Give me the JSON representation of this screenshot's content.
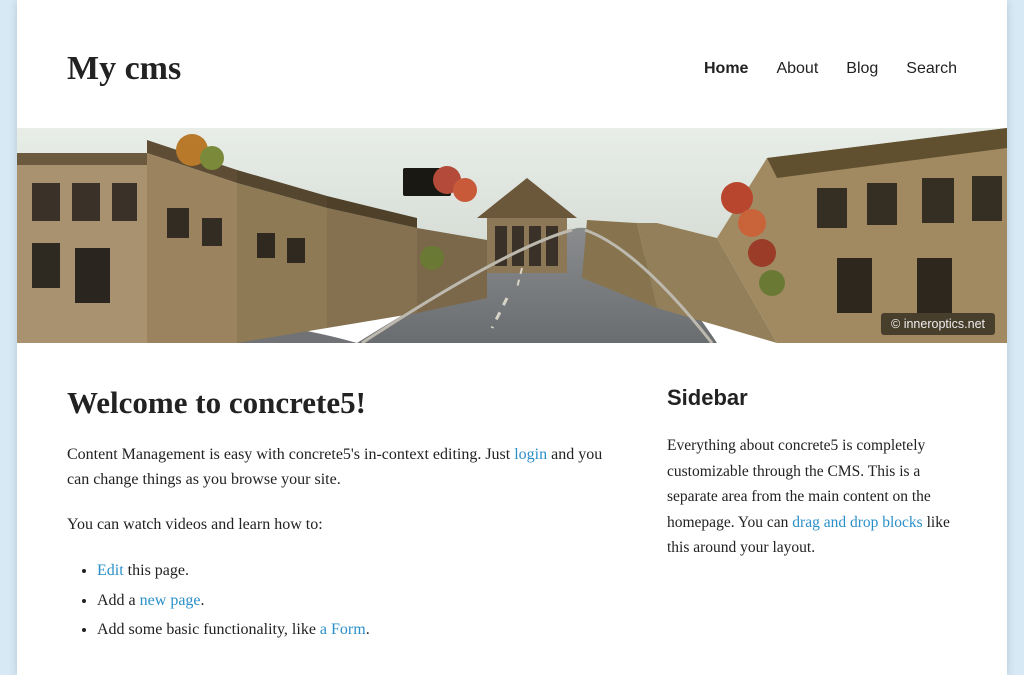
{
  "site_title": "My cms",
  "nav": {
    "items": [
      {
        "label": "Home",
        "active": true
      },
      {
        "label": "About",
        "active": false
      },
      {
        "label": "Blog",
        "active": false
      },
      {
        "label": "Search",
        "active": false
      }
    ]
  },
  "hero": {
    "credit": "© inneroptics.net"
  },
  "main": {
    "heading": "Welcome to concrete5!",
    "para1_a": "Content Management is easy with concrete5's in-context editing. Just ",
    "para1_link": "login",
    "para1_b": " and you can change things as you browse your site.",
    "para2": "You can watch videos and learn how to:",
    "list": {
      "item1_link": "Edit",
      "item1_rest": " this page.",
      "item2_a": "Add a ",
      "item2_link": "new page",
      "item2_b": ".",
      "item3_a": "Add some basic functionality, like ",
      "item3_link": "a Form",
      "item3_b": "."
    }
  },
  "sidebar": {
    "heading": "Sidebar",
    "text_a": "Everything about concrete5 is completely customizable through the CMS. This is a separate area from the main content on the homepage. You can ",
    "text_link": "drag and drop blocks",
    "text_b": " like this around your layout."
  }
}
